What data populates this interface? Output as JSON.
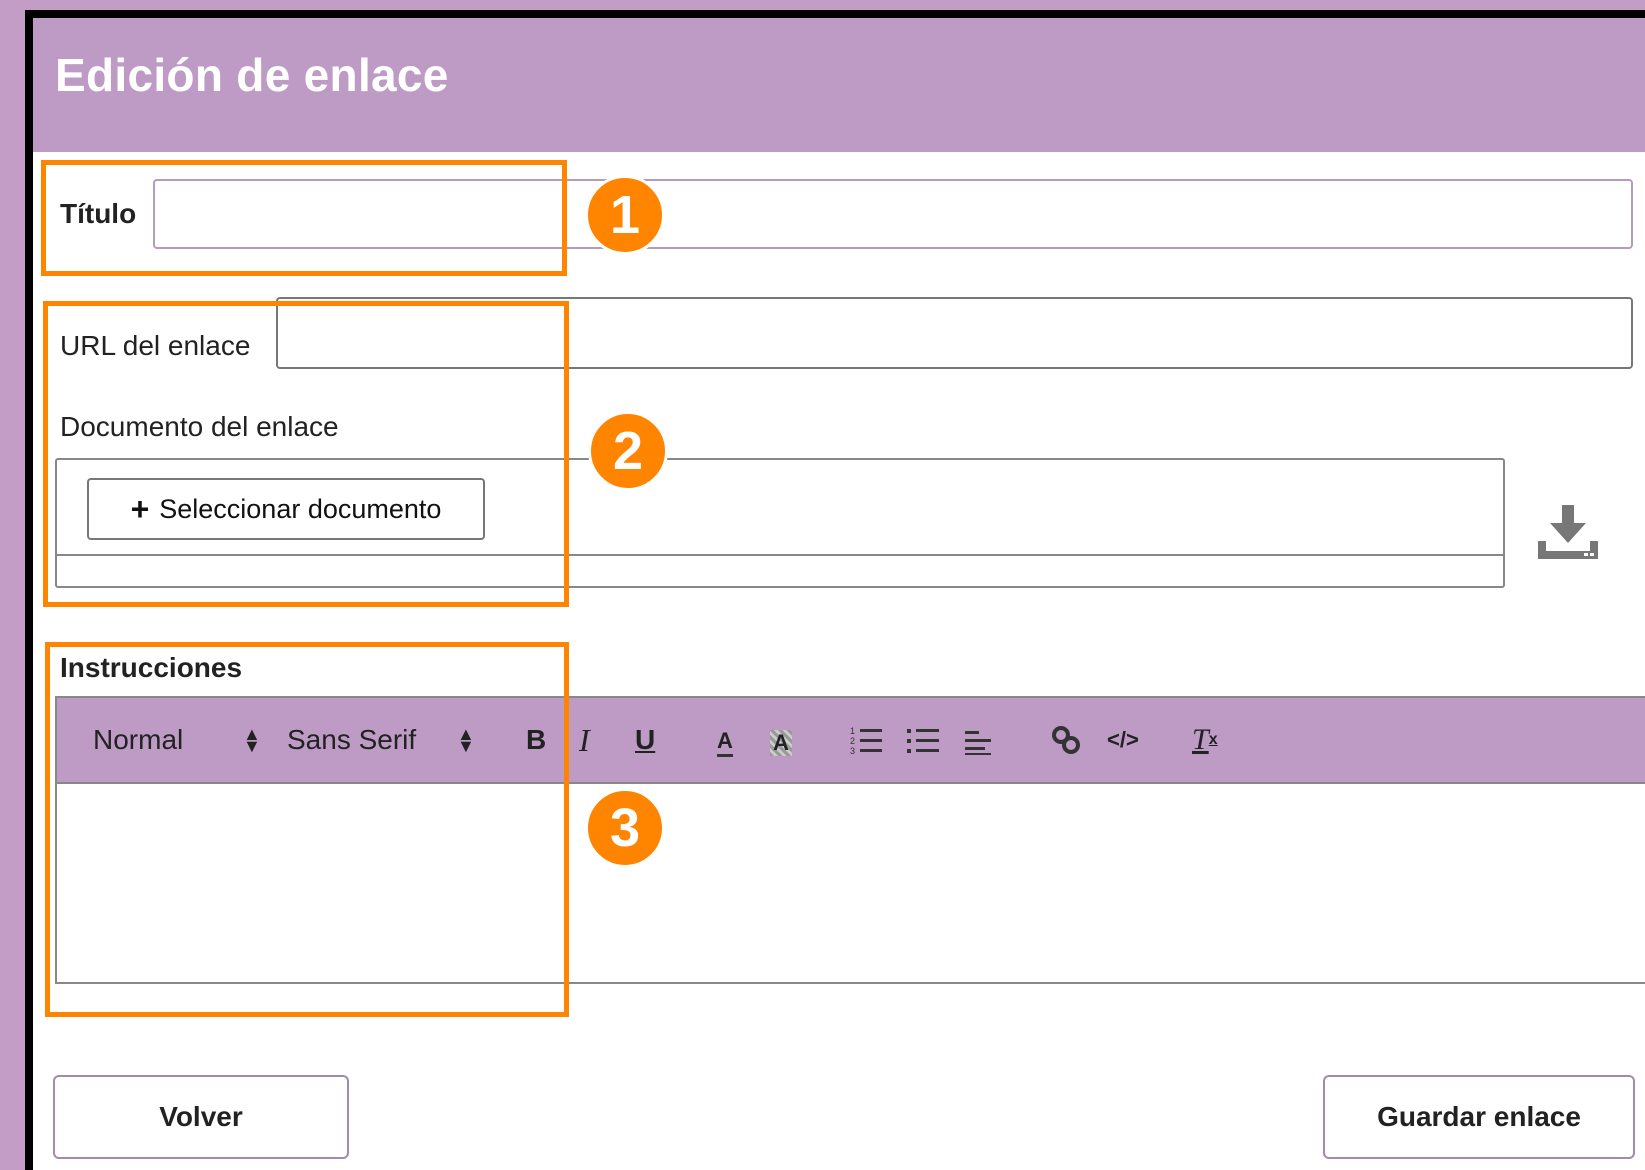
{
  "dialog": {
    "title": "Edición de enlace"
  },
  "form": {
    "title_label": "Título",
    "title_value": "",
    "url_label": "URL del enlace",
    "url_value": "",
    "document_label": "Documento del enlace",
    "select_document_button": "Seleccionar documento",
    "instructions_label": "Instrucciones",
    "instructions_value": ""
  },
  "toolbar": {
    "format_select": "Normal",
    "font_select": "Sans Serif",
    "bold": "B",
    "italic": "I",
    "underline": "U",
    "font_color": "A",
    "background_color": "A",
    "icons": [
      "ordered-list-icon",
      "bullet-list-icon",
      "align-icon",
      "link-icon",
      "code-icon",
      "clear-format-icon"
    ]
  },
  "actions": {
    "back_button": "Volver",
    "save_button": "Guardar enlace"
  },
  "annotations": {
    "markers": [
      "1",
      "2",
      "3"
    ],
    "color": "#ff8400"
  },
  "theme": {
    "header_color": "#bd9bc5",
    "page_background": "#c39dc6"
  }
}
